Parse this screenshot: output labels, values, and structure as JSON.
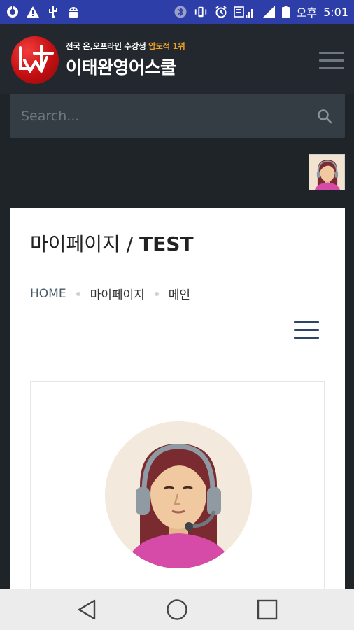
{
  "status_bar": {
    "left_icons": [
      "sync-icon",
      "warning-icon",
      "usb-icon",
      "android-debug-icon"
    ],
    "right_icons": [
      "bluetooth-icon",
      "vibrate-icon",
      "alarm-icon",
      "network-type-icon",
      "signal-icon",
      "battery-icon"
    ],
    "ampm": "오후",
    "time": "5:01",
    "colors": {
      "background": "#2d3ea8"
    }
  },
  "header": {
    "tagline_main": "전국 온,오프라인 수강생",
    "tagline_accent": "압도적 1위",
    "brand": "이태완영어스쿨",
    "menu_icon": "hamburger-menu-icon",
    "colors": {
      "background": "#22282d",
      "accent": "#f0a02a",
      "logo": "#c30f12"
    }
  },
  "search": {
    "placeholder": "Search...",
    "icon": "search-icon"
  },
  "page": {
    "title_prefix": "마이페이지 / ",
    "title_bold": "TEST",
    "breadcrumb": {
      "home": "HOME",
      "section": "마이페이지",
      "current": "메인"
    }
  },
  "nav_bar": {
    "buttons": [
      "back-icon",
      "home-icon",
      "recents-icon"
    ]
  }
}
